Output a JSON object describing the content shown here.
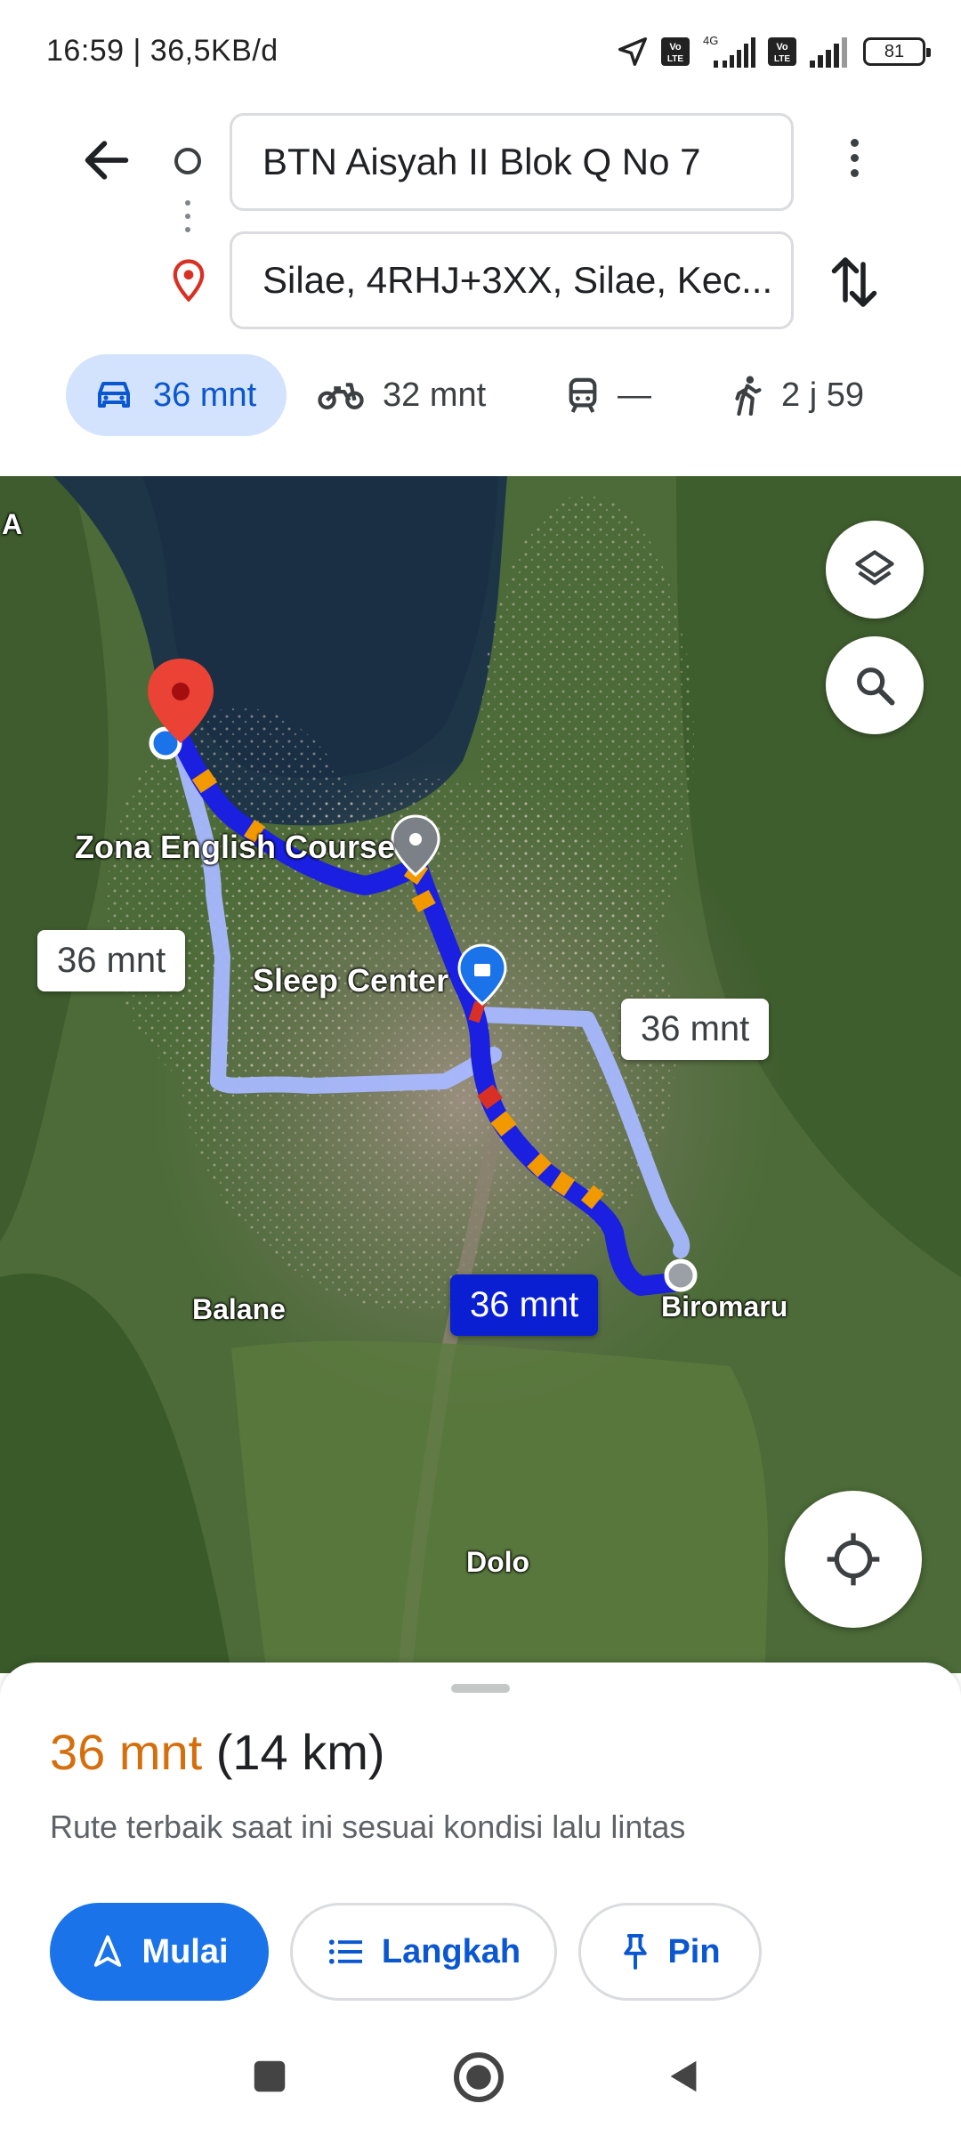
{
  "status_bar": {
    "time_speed": "16:59 | 36,5KB/d",
    "network_label": "4G",
    "volte_label": "Vo LTE",
    "battery": "81"
  },
  "directions": {
    "origin": "BTN Aisyah II Blok Q No 7",
    "destination": "Silae, 4RHJ+3XX, Silae, Kec..."
  },
  "modes": [
    {
      "name": "car",
      "label": "36 mnt",
      "icon": "car-icon"
    },
    {
      "name": "motorcycle",
      "label": "32 mnt",
      "icon": "motorcycle-icon"
    },
    {
      "name": "transit",
      "label": "—",
      "icon": "train-icon"
    },
    {
      "name": "walk",
      "label": "2 j 59",
      "icon": "walk-icon"
    }
  ],
  "map": {
    "places": {
      "zona": "Zona English Course",
      "sleep": "Sleep Center",
      "balane": "Balane",
      "biromaru": "Biromaru",
      "dolo": "Dolo",
      "edge": "A"
    },
    "callouts": {
      "left": "36 mnt",
      "right": "36 mnt",
      "active": "36 mnt"
    },
    "colors": {
      "route_active": "#1a1fe0",
      "route_alt": "#a8b8ff",
      "traffic": "#f29900"
    }
  },
  "sheet": {
    "eta": "36 mnt",
    "distance": "(14 km)",
    "description": "Rute terbaik saat ini sesuai kondisi lalu lintas",
    "start_label": "Mulai",
    "steps_label": "Langkah",
    "pin_label": "Pin"
  }
}
